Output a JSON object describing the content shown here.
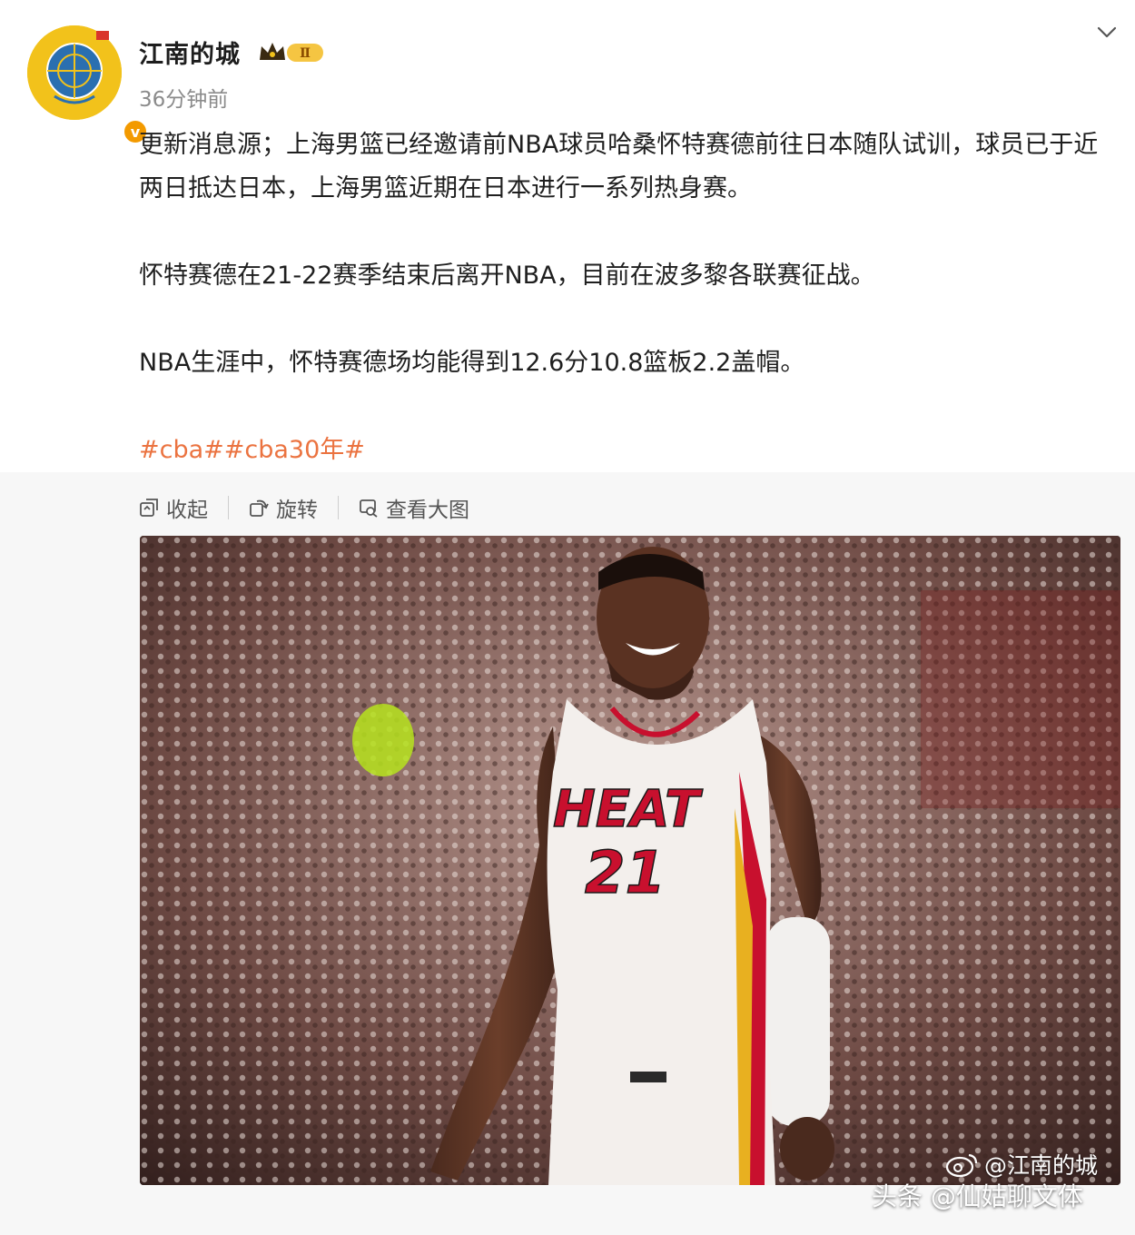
{
  "post": {
    "username": "江南的城",
    "member_level": "Ⅱ",
    "timestamp": "36分钟前",
    "paragraphs": [
      "更新消息源；上海男篮已经邀请前NBA球员哈桑怀特赛德前往日本随队试训，球员已于近两日抵达日本，上海男篮近期在日本进行一系列热身赛。",
      "怀特赛德在21-22赛季结束后离开NBA，目前在波多黎各联赛征战。",
      "NBA生涯中，怀特赛德场均能得到12.6分10.8篮板2.2盖帽。"
    ],
    "hashtags": "#cba##cba30年#"
  },
  "toolbar": {
    "collapse_label": "收起",
    "rotate_label": "旋转",
    "view_large_label": "查看大图"
  },
  "photo": {
    "jersey_team": "HEAT",
    "jersey_number": "21"
  },
  "watermarks": {
    "weibo": "@江南的城",
    "toutiao": "头条 @仙姑聊文体"
  },
  "colors": {
    "hashtag": "#eb7340",
    "verified_badge": "#f39a00",
    "avatar_bg": "#f2c21b",
    "jersey_red": "#c8102e"
  }
}
